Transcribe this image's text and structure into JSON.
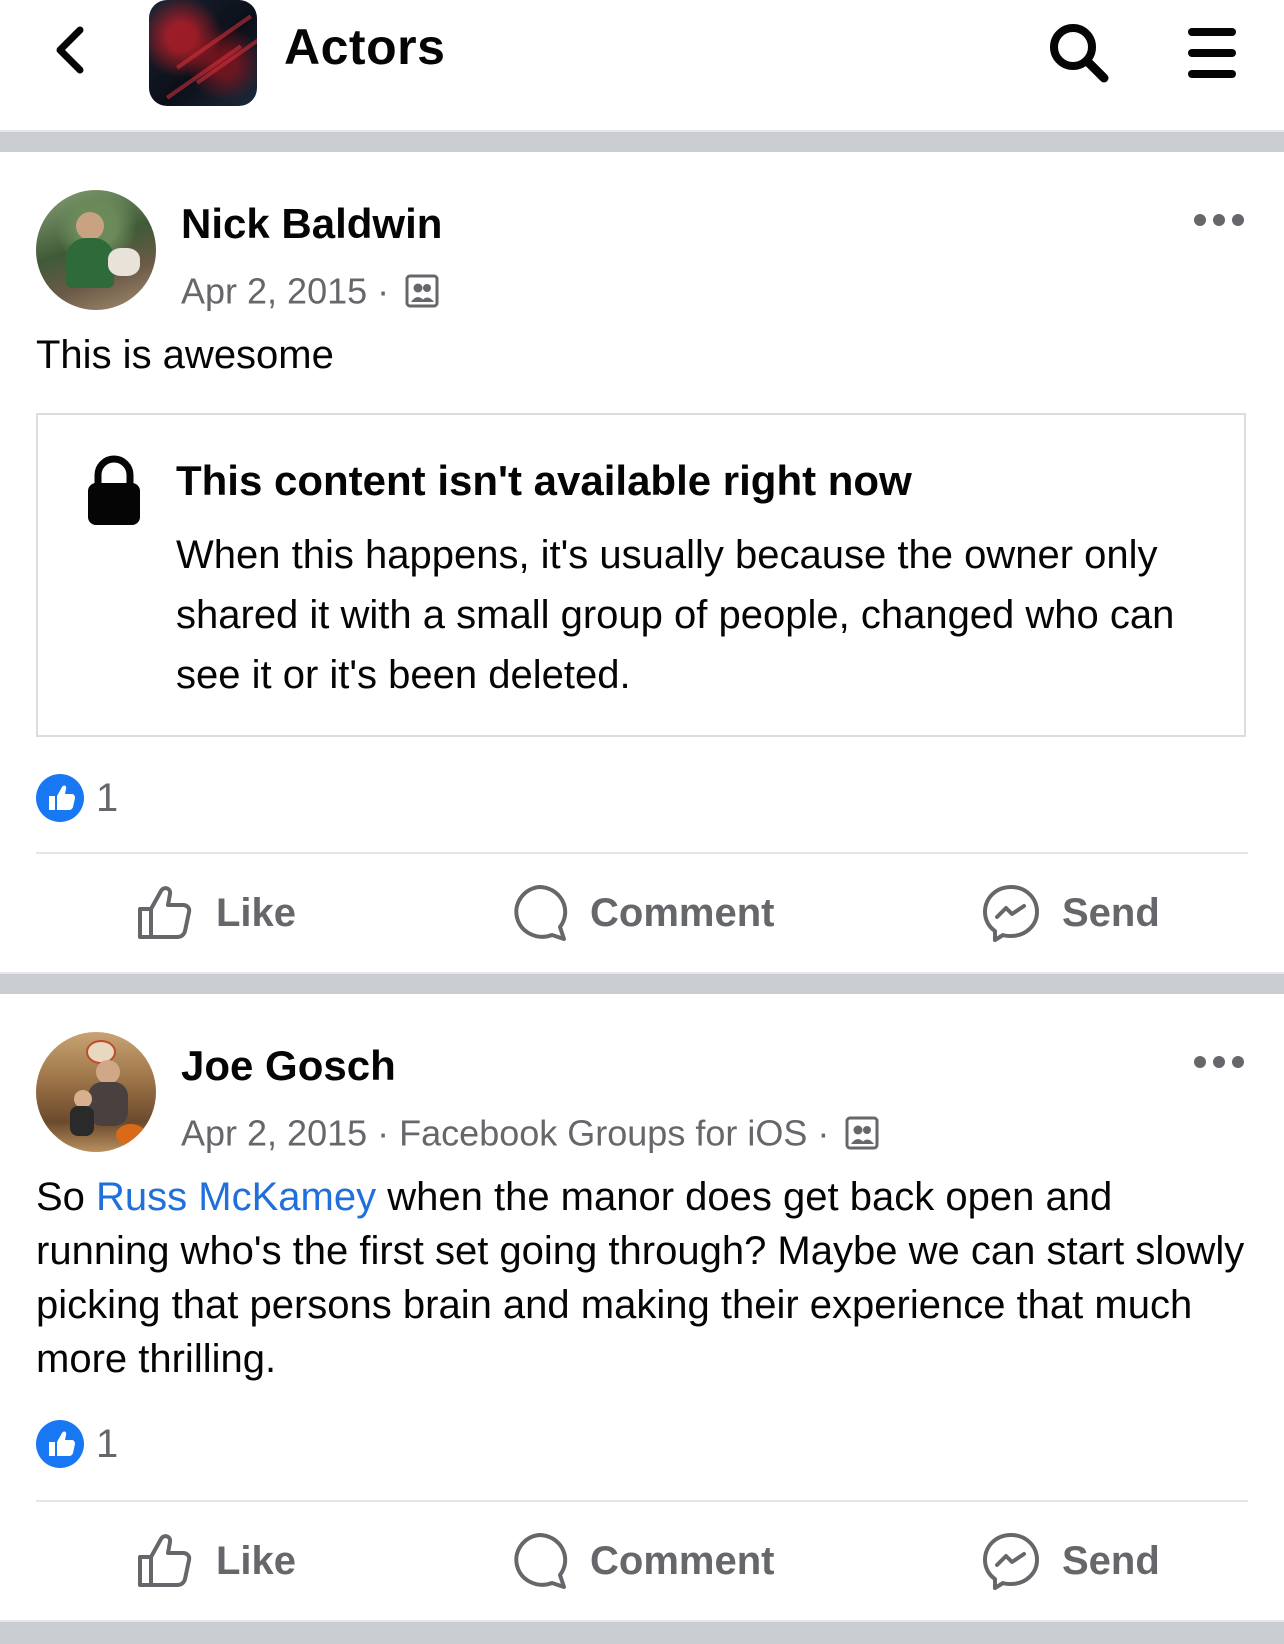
{
  "header": {
    "title": "Actors",
    "back_icon": "chevron-left-icon",
    "search_icon": "search-icon",
    "menu_icon": "hamburger-menu-icon"
  },
  "posts": [
    {
      "author": "Nick Baldwin",
      "date": "Apr 2, 2015",
      "separator": "·",
      "source": "",
      "privacy_icon": "group-members-icon",
      "text": "This is awesome",
      "unavailable": {
        "title": "This content isn't available right now",
        "body": "When this happens, it's usually because the owner only shared it with a small group of people, changed who can see it or it's been deleted."
      },
      "reaction_count": "1"
    },
    {
      "author": "Joe Gosch",
      "date": "Apr 2, 2015",
      "separator": "·",
      "source": "Facebook Groups for iOS",
      "privacy_icon": "group-members-icon",
      "text_prefix": "So ",
      "mention": "Russ McKamey",
      "text_suffix": " when the manor does get back open and running who's the first set going through? Maybe we can start slowly picking that persons brain and making their experience that much more thrilling.",
      "reaction_count": "1"
    }
  ],
  "actions": {
    "like": "Like",
    "comment": "Comment",
    "send": "Send"
  },
  "colors": {
    "brand_blue": "#1877f2",
    "mention_blue": "#216fdb",
    "secondary_text": "#65676b",
    "separator": "#c9ccd1"
  }
}
